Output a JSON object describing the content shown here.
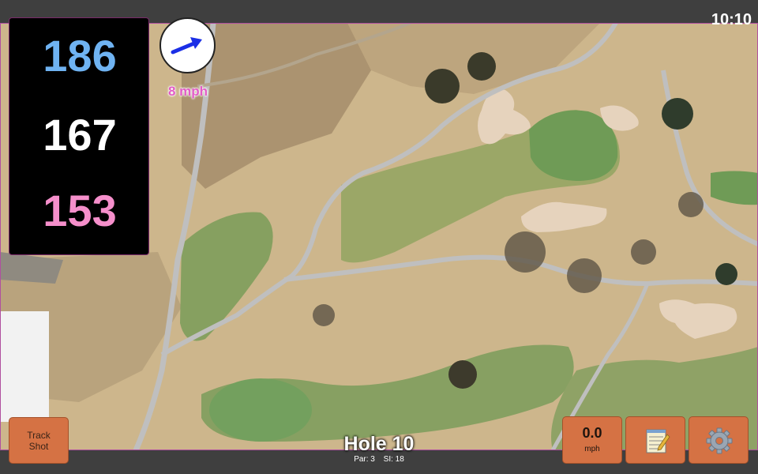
{
  "status": {
    "clock": "10:10"
  },
  "distances": {
    "back": "186",
    "middle": "167",
    "front": "153"
  },
  "colors": {
    "back": "#6fb3f2",
    "middle": "#ffffff",
    "front": "#f58fcb",
    "button": "#d57244",
    "wind_arrow": "#1b2fe6"
  },
  "wind": {
    "speed": "8 mph",
    "arrow_icon": "wind-arrow-icon"
  },
  "buttons": {
    "track_shot": {
      "line1": "Track",
      "line2": "Shot"
    },
    "speed": {
      "value": "0.0",
      "unit": "mph"
    },
    "notes_icon": "notepad-icon",
    "settings_icon": "gear-icon"
  },
  "hole": {
    "title": "Hole 10",
    "par": "Par: 3",
    "si": "SI: 18"
  }
}
